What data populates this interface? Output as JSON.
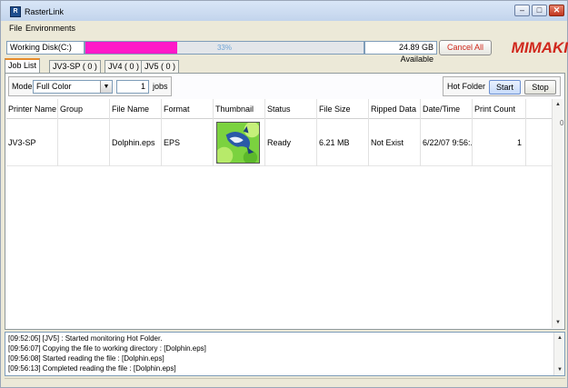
{
  "window": {
    "title": "RasterLink",
    "app_icon": "rasterlink-icon",
    "controls": [
      "minimize-icon",
      "maximize-icon",
      "close-icon"
    ]
  },
  "menu": {
    "file": "File",
    "environments": "Environments"
  },
  "disk": {
    "label": "Working Disk(C:)",
    "usage_percent_text": "33%",
    "usage_fraction": 0.33,
    "available": "24.89 GB Available",
    "cancel_all": "Cancel All",
    "fill_color": "#ff19c8"
  },
  "logo": {
    "text": "MIMAKI",
    "color": "#d0281d"
  },
  "tabs": [
    {
      "label": "Job List"
    },
    {
      "label": "JV3-SP ( 0 )"
    },
    {
      "label": "JV4 ( 0 )"
    },
    {
      "label": "JV5 ( 0 )"
    }
  ],
  "toolbar": {
    "mode_label": "Mode",
    "mode_value": "Full Color",
    "jobs_count": "1",
    "jobs_label": "jobs",
    "hot_folder_label": "Hot Folder",
    "start": "Start",
    "stop": "Stop"
  },
  "table": {
    "columns": [
      "Printer Name",
      "Group",
      "File Name",
      "Format",
      "Thumbnail",
      "Status",
      "File Size",
      "Ripped Data",
      "Date/Time",
      "Print Count"
    ],
    "rows": [
      {
        "printer": "JV3-SP",
        "group": "",
        "file_name": "Dolphin.eps",
        "format": "EPS",
        "thumbnail": "dolphin-thumbnail",
        "status": "Ready",
        "file_size": "6.21 MB",
        "ripped": "Not Exist",
        "datetime": "6/22/07 9:56:...",
        "print_count": "1"
      }
    ]
  },
  "side_marker": "0",
  "log": [
    "[09:52:05] [JV5] : Started monitoring Hot Folder.",
    "[09:56:07] Copying the file to working directory : [Dolphin.eps]",
    "[09:56:08] Started reading the file : [Dolphin.eps]",
    "[09:56:13] Completed reading the file : [Dolphin.eps]"
  ]
}
